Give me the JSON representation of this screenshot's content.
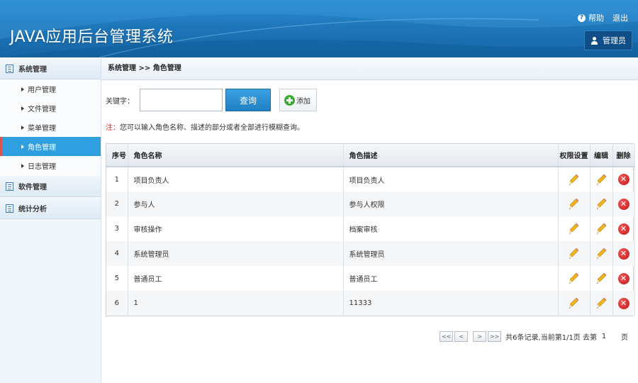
{
  "header": {
    "title": "JAVA应用后台管理系统",
    "help": "帮助",
    "logout": "退出",
    "user": "管理员"
  },
  "sidebar": {
    "groups": [
      {
        "label": "系统管理",
        "items": [
          {
            "label": "用户管理"
          },
          {
            "label": "文件管理"
          },
          {
            "label": "菜单管理"
          },
          {
            "label": "角色管理",
            "active": true
          },
          {
            "label": "日志管理"
          }
        ]
      },
      {
        "label": "软件管理"
      },
      {
        "label": "统计分析"
      }
    ]
  },
  "breadcrumb": "系统管理 >> 角色管理",
  "search": {
    "label": "关键字：",
    "value": "",
    "button": "查询",
    "add": "添加"
  },
  "note": {
    "prefix": "注：",
    "text": "您可以输入角色名称、描述的部分或者全部进行模糊查询。"
  },
  "table": {
    "headers": [
      "序号",
      "角色名称",
      "角色描述",
      "权限设置",
      "编辑",
      "删除"
    ],
    "rows": [
      {
        "no": "1",
        "name": "项目负责人",
        "desc": "项目负责人"
      },
      {
        "no": "2",
        "name": "参与人",
        "desc": "参与人权限"
      },
      {
        "no": "3",
        "name": "审核操作",
        "desc": "档案审核"
      },
      {
        "no": "4",
        "name": "系统管理员",
        "desc": "系统管理员"
      },
      {
        "no": "5",
        "name": "普通员工",
        "desc": "普通员工"
      },
      {
        "no": "6",
        "name": "1",
        "desc": "11333"
      }
    ]
  },
  "pager": {
    "first": "<<",
    "prev": "<",
    "next": ">",
    "last": ">>",
    "summary": "共6条记录,当前第1/1页 去第",
    "goto_value": "1",
    "unit": "页"
  },
  "colors": {
    "header": "#1d73b6",
    "active_nav": "#2f9fe0",
    "search_button": "#2a8fd4",
    "note_red": "#d9241c",
    "delete_red": "#d21f1f",
    "add_green": "#3aaa35"
  }
}
